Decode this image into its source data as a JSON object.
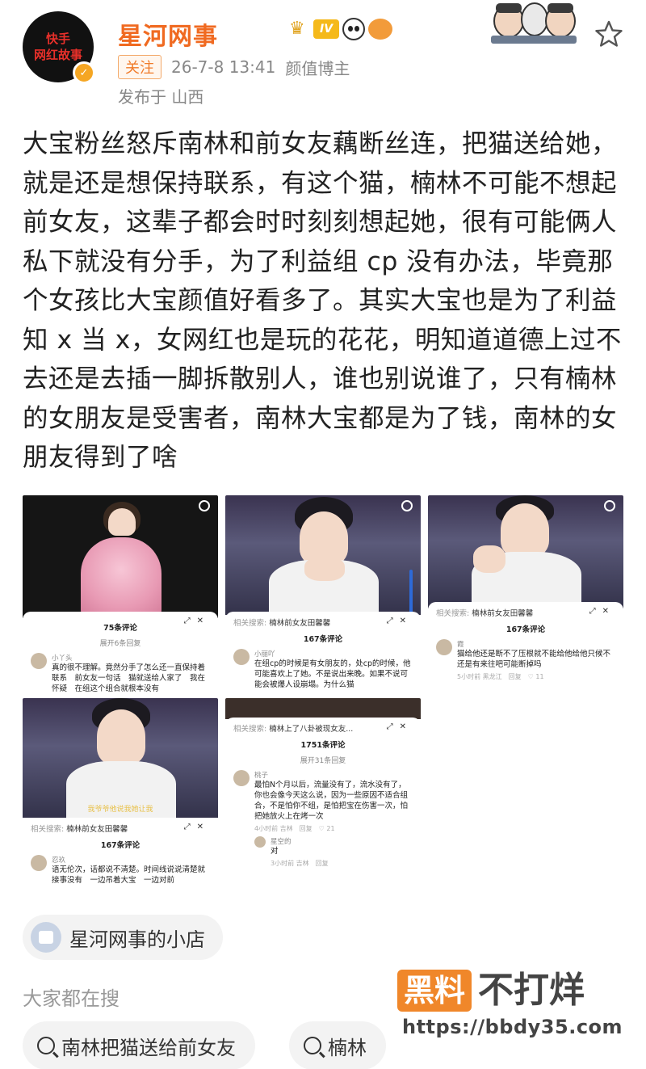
{
  "header": {
    "avatar_lines": [
      "快手",
      "网红故事"
    ],
    "username": "星河网事",
    "level_badge": "IV",
    "follow_label": "关注",
    "timestamp": "26-7-8 13:41",
    "category": "颜值博主",
    "location": "发布于 山西",
    "verified_icon": "v-badge-icon",
    "favorite_icon": "star-icon"
  },
  "post": {
    "text": "大宝粉丝怒斥南林和前女友藕断丝连，把猫送给她，就是还是想保持联系，有这个猫，楠林不可能不想起前女友，这辈子都会时时刻刻想起她，很有可能俩人私下就没有分手，为了利益组 cp 没有办法，毕竟那个女孩比大宝颜值好看多了。其实大宝也是为了利益知 x 当 x，女网红也是玩的花花，明知道道德上过不去还是去插一脚拆散别人，谁也别说谁了，只有楠林的女朋友是受害者，南林大宝都是为了钱，南林的女朋友得到了啥"
  },
  "images": [
    {
      "count": "75条评论",
      "expand": "展开6条回复",
      "comment_name": "小丫头",
      "comment_text": "真的很不理解。竟然分手了怎么还一直保持着联系　前女友一句话　猫就送给人家了　我在怀疑　在组这个组合就根本没有"
    },
    {
      "related": "相关搜索:",
      "related_term": "楠林前女友田馨馨",
      "count": "167条评论",
      "comment_name": "小丽吖",
      "comment_text": "在组cp的时候是有女朋友的，处cp的时候，他可能喜欢上了她。不是说出来晚。如果不说可能会被爆人设崩塌。为什么猫"
    },
    {
      "related": "相关搜索:",
      "related_term": "楠林前女友田馨馨",
      "count": "167条评论",
      "comment_name": "霞",
      "comment_text": "猫给他还是断不了压根就不能给他给他只候不还是有来往吧可能断掉吗",
      "comment_meta": "5小时前 黑龙江　回复",
      "likes": "11"
    },
    {
      "related": "相关搜索:",
      "related_term": "楠林前女友田馨馨",
      "count": "167条评论",
      "caption": "我爷爷他说我她让我",
      "comment_name": "忍玖",
      "comment_text": "语无伦次，话都说不清楚。时间线说说清楚就接事没有　一边吊着大宝　一边对前"
    },
    {
      "related": "相关搜索:",
      "related_term": "楠林上了八卦被现女友...",
      "count": "1751条评论",
      "expand": "展开31条回复",
      "comment_name": "桃子",
      "comment_text": "最怕N个月以后，流量没有了，流水没有了，你也会像今天这么说，因为一些原因不适合组合，不是怕你不组，是怕把宝在伤害一次，怕把她放火上在烤一次",
      "comment_meta": "4小时前 吉林　回复",
      "likes": "21",
      "reply_name": "星空的",
      "reply_text": "对",
      "reply_meta": "3小时前 吉林　回复"
    }
  ],
  "shop": {
    "label": "星河网事的小店"
  },
  "trending": {
    "title": "大家都在搜",
    "chips": [
      "南林把猫送给前女友",
      "楠林"
    ]
  },
  "watermark": {
    "box": "黑料",
    "text": "不打烊",
    "url": "https://bbdy35.com"
  }
}
